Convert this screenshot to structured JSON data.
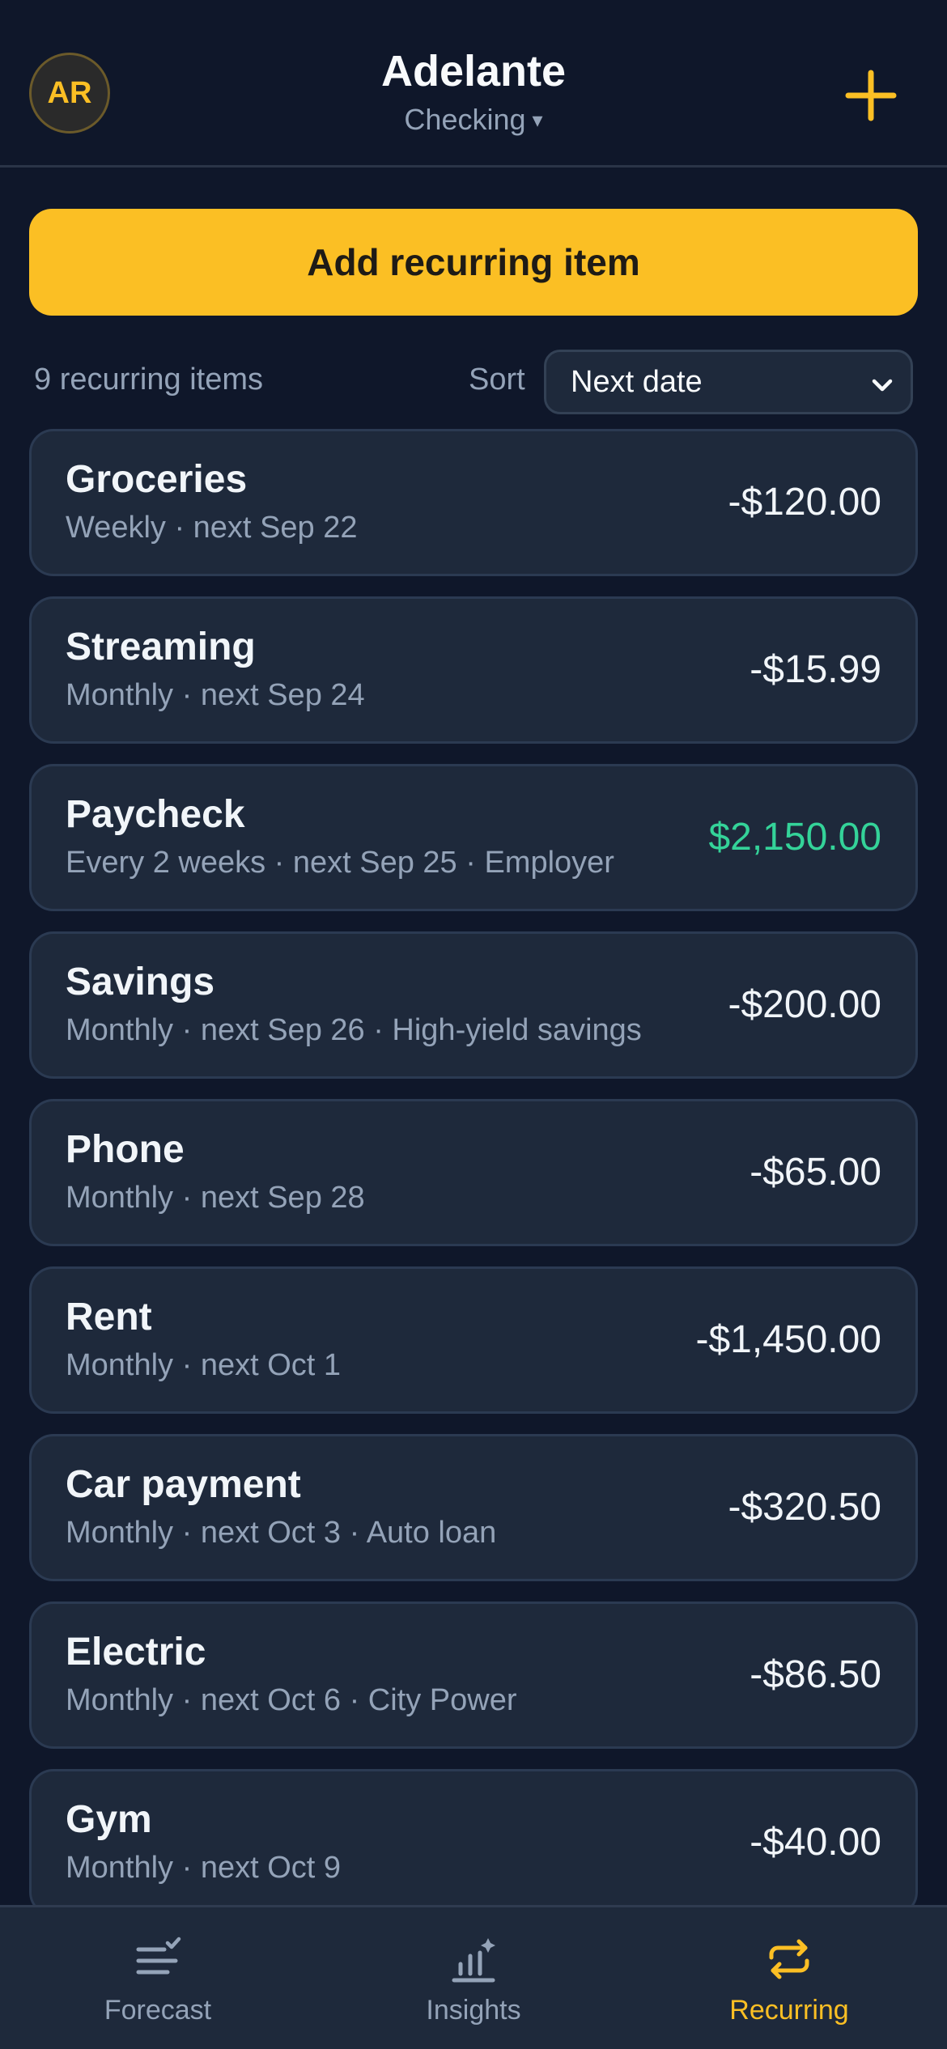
{
  "header": {
    "avatar_initials": "AR",
    "title": "Adelante",
    "account": "Checking",
    "account_caret": "▾"
  },
  "actions": {
    "add_recurring_label": "Add recurring item"
  },
  "controls": {
    "items_count": "9 recurring items",
    "sort_label": "Sort",
    "sort_value": "Next date"
  },
  "items": [
    {
      "name": "Groceries",
      "meta": "Weekly · next Sep 22",
      "amount": "-$120.00",
      "positive": false
    },
    {
      "name": "Streaming",
      "meta": "Monthly · next Sep 24",
      "amount": "-$15.99",
      "positive": false
    },
    {
      "name": "Paycheck",
      "meta": "Every 2 weeks · next Sep 25 · Employer",
      "amount": "$2,150.00",
      "positive": true
    },
    {
      "name": "Savings",
      "meta": "Monthly · next Sep 26 · High-yield savings",
      "amount": "-$200.00",
      "positive": false
    },
    {
      "name": "Phone",
      "meta": "Monthly · next Sep 28",
      "amount": "-$65.00",
      "positive": false
    },
    {
      "name": "Rent",
      "meta": "Monthly · next Oct 1",
      "amount": "-$1,450.00",
      "positive": false
    },
    {
      "name": "Car payment",
      "meta": "Monthly · next Oct 3 · Auto loan",
      "amount": "-$320.50",
      "positive": false
    },
    {
      "name": "Electric",
      "meta": "Monthly · next Oct 6 · City Power",
      "amount": "-$86.50",
      "positive": false
    },
    {
      "name": "Gym",
      "meta": "Monthly · next Oct 9",
      "amount": "-$40.00",
      "positive": false
    }
  ],
  "nav": {
    "forecast": "Forecast",
    "insights": "Insights",
    "recurring": "Recurring",
    "active": "recurring"
  },
  "colors": {
    "background": "#0f172a",
    "surface": "#1e293b",
    "accent": "#fbbf24",
    "positive": "#34d399",
    "muted": "#94a3b8"
  }
}
